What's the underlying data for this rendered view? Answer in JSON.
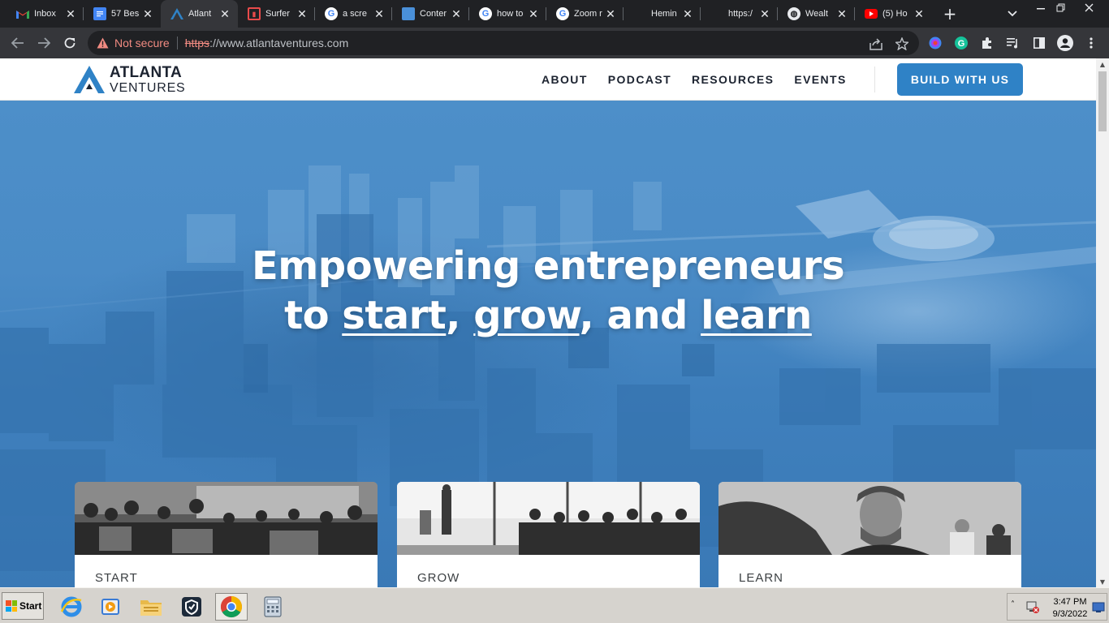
{
  "browser": {
    "tabs": [
      {
        "title": "Inbox",
        "favicon": "gmail-icon",
        "color": "#ea4335"
      },
      {
        "title": "57 Bes",
        "favicon": "docs-icon",
        "color": "#4285f4"
      },
      {
        "title": "Atlant",
        "favicon": "atlanta-ventures-icon",
        "color": "#2f82c6"
      },
      {
        "title": "Surfer",
        "favicon": "surfer-icon",
        "color": "#e94b4b"
      },
      {
        "title": "a scre",
        "favicon": "google-icon",
        "color": "#4285f4"
      },
      {
        "title": "Conter",
        "favicon": "content-icon",
        "color": "#4a90d9"
      },
      {
        "title": "how to",
        "favicon": "google-icon",
        "color": "#4285f4"
      },
      {
        "title": "Zoom r",
        "favicon": "google-icon",
        "color": "#4285f4"
      },
      {
        "title": "Hemin",
        "favicon": "hemingway-icon",
        "color": "#202124"
      },
      {
        "title": "https:/",
        "favicon": "blank-icon",
        "color": "#202124"
      },
      {
        "title": "Wealt",
        "favicon": "globe-icon",
        "color": "#e8eaed"
      },
      {
        "title": "(5) Ho",
        "favicon": "youtube-icon",
        "color": "#ff0000"
      }
    ],
    "security_label": "Not secure",
    "url_scheme": "https",
    "url_rest": "://www.atlantaventures.com"
  },
  "site": {
    "logo": {
      "line1": "ATLANTA",
      "line2": "VENTURES"
    },
    "nav": [
      "ABOUT",
      "PODCAST",
      "RESOURCES",
      "EVENTS"
    ],
    "cta": "BUILD WITH US",
    "hero": {
      "line1": "Empowering entrepreneurs",
      "line2_prefix": "to ",
      "word1": "start",
      "sep1": ", ",
      "word2": "grow",
      "sep2": ", and ",
      "word3": "learn"
    },
    "cards": [
      {
        "label": "START"
      },
      {
        "label": "GROW"
      },
      {
        "label": "LEARN"
      }
    ],
    "colors": {
      "brand_blue": "#2f82c6",
      "hero_blue": "#4a8bc6",
      "text_dark": "#1c2330"
    }
  },
  "taskbar": {
    "start_label": "Start",
    "apps": [
      "internet-explorer-icon",
      "media-player-icon",
      "file-explorer-icon",
      "vpn-shield-icon",
      "chrome-icon",
      "calculator-icon"
    ],
    "time": "3:47 PM",
    "date": "9/3/2022"
  }
}
